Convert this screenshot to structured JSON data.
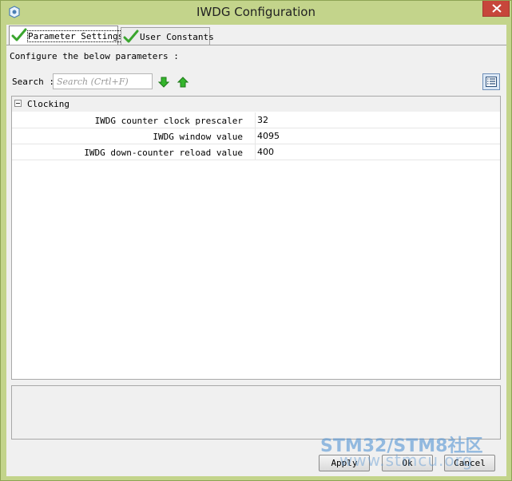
{
  "window": {
    "title": "IWDG Configuration",
    "frame_color": "#c3d48b",
    "close_color": "#c7463b"
  },
  "tabs": [
    {
      "label": "Parameter Settings",
      "active": true,
      "icon": "green-check-icon"
    },
    {
      "label": "User Constants",
      "active": false,
      "icon": "green-check-icon"
    }
  ],
  "content": {
    "instructions": "Configure the below parameters :",
    "search_label": "Search :",
    "search_placeholder": "Search (Crtl+F)",
    "search_value": ""
  },
  "tree": {
    "group": {
      "label": "Clocking",
      "expanded": true
    },
    "params": [
      {
        "name": "IWDG counter clock prescaler",
        "value": "32"
      },
      {
        "name": "IWDG window value",
        "value": "4095"
      },
      {
        "name": "IWDG down-counter reload value",
        "value": "400"
      }
    ]
  },
  "buttons": {
    "apply": "Apply",
    "ok": "Ok",
    "cancel": "Cancel"
  },
  "watermark": {
    "line1": "STM32/STM8社区",
    "line2": "www.stmcu.org"
  }
}
